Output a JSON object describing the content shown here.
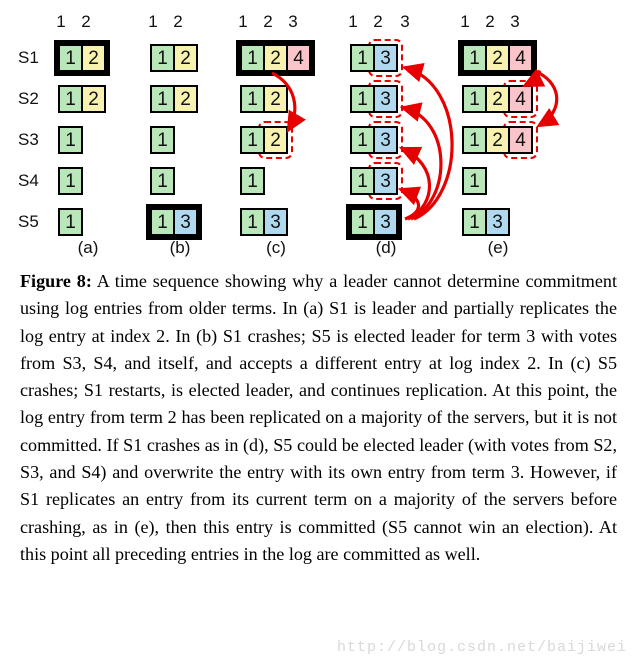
{
  "figure": {
    "row_labels": [
      "S1",
      "S2",
      "S3",
      "S4",
      "S5"
    ],
    "panels": [
      {
        "id": "a",
        "label": "(a)",
        "column_headers": [
          "1",
          "2"
        ],
        "rows": [
          {
            "server": "S1",
            "leader": true,
            "cells": [
              {
                "term": "1",
                "color": "green"
              },
              {
                "term": "2",
                "color": "yellow"
              }
            ]
          },
          {
            "server": "S2",
            "leader": false,
            "cells": [
              {
                "term": "1",
                "color": "green"
              },
              {
                "term": "2",
                "color": "yellow"
              }
            ]
          },
          {
            "server": "S3",
            "leader": false,
            "cells": [
              {
                "term": "1",
                "color": "green"
              }
            ]
          },
          {
            "server": "S4",
            "leader": false,
            "cells": [
              {
                "term": "1",
                "color": "green"
              }
            ]
          },
          {
            "server": "S5",
            "leader": false,
            "cells": [
              {
                "term": "1",
                "color": "green"
              }
            ]
          }
        ]
      },
      {
        "id": "b",
        "label": "(b)",
        "column_headers": [
          "1",
          "2"
        ],
        "rows": [
          {
            "server": "S1",
            "leader": false,
            "cells": [
              {
                "term": "1",
                "color": "green"
              },
              {
                "term": "2",
                "color": "yellow"
              }
            ]
          },
          {
            "server": "S2",
            "leader": false,
            "cells": [
              {
                "term": "1",
                "color": "green"
              },
              {
                "term": "2",
                "color": "yellow"
              }
            ]
          },
          {
            "server": "S3",
            "leader": false,
            "cells": [
              {
                "term": "1",
                "color": "green"
              }
            ]
          },
          {
            "server": "S4",
            "leader": false,
            "cells": [
              {
                "term": "1",
                "color": "green"
              }
            ]
          },
          {
            "server": "S5",
            "leader": true,
            "cells": [
              {
                "term": "1",
                "color": "green"
              },
              {
                "term": "3",
                "color": "blue"
              }
            ]
          }
        ]
      },
      {
        "id": "c",
        "label": "(c)",
        "column_headers": [
          "1",
          "2",
          "3"
        ],
        "rows": [
          {
            "server": "S1",
            "leader": true,
            "cells": [
              {
                "term": "1",
                "color": "green"
              },
              {
                "term": "2",
                "color": "yellow"
              },
              {
                "term": "4",
                "color": "pink"
              }
            ]
          },
          {
            "server": "S2",
            "leader": false,
            "cells": [
              {
                "term": "1",
                "color": "green"
              },
              {
                "term": "2",
                "color": "yellow"
              }
            ]
          },
          {
            "server": "S3",
            "leader": false,
            "cells": [
              {
                "term": "1",
                "color": "green"
              },
              {
                "term": "2",
                "color": "yellow",
                "highlight": true
              }
            ]
          },
          {
            "server": "S4",
            "leader": false,
            "cells": [
              {
                "term": "1",
                "color": "green"
              }
            ]
          },
          {
            "server": "S5",
            "leader": false,
            "cells": [
              {
                "term": "1",
                "color": "green"
              },
              {
                "term": "3",
                "color": "blue"
              }
            ]
          }
        ]
      },
      {
        "id": "d",
        "label": "(d)",
        "column_headers": [
          "1",
          "2",
          "3"
        ],
        "rows": [
          {
            "server": "S1",
            "leader": false,
            "cells": [
              {
                "term": "1",
                "color": "green"
              },
              {
                "term": "3",
                "color": "blue",
                "highlight": true
              }
            ]
          },
          {
            "server": "S2",
            "leader": false,
            "cells": [
              {
                "term": "1",
                "color": "green"
              },
              {
                "term": "3",
                "color": "blue",
                "highlight": true
              }
            ]
          },
          {
            "server": "S3",
            "leader": false,
            "cells": [
              {
                "term": "1",
                "color": "green"
              },
              {
                "term": "3",
                "color": "blue",
                "highlight": true
              }
            ]
          },
          {
            "server": "S4",
            "leader": false,
            "cells": [
              {
                "term": "1",
                "color": "green"
              },
              {
                "term": "3",
                "color": "blue",
                "highlight": true
              }
            ]
          },
          {
            "server": "S5",
            "leader": true,
            "cells": [
              {
                "term": "1",
                "color": "green"
              },
              {
                "term": "3",
                "color": "blue"
              }
            ]
          }
        ]
      },
      {
        "id": "e",
        "label": "(e)",
        "column_headers": [
          "1",
          "2",
          "3"
        ],
        "rows": [
          {
            "server": "S1",
            "leader": true,
            "cells": [
              {
                "term": "1",
                "color": "green"
              },
              {
                "term": "2",
                "color": "yellow"
              },
              {
                "term": "4",
                "color": "pink"
              }
            ]
          },
          {
            "server": "S2",
            "leader": false,
            "cells": [
              {
                "term": "1",
                "color": "green"
              },
              {
                "term": "2",
                "color": "yellow"
              },
              {
                "term": "4",
                "color": "pink",
                "highlight": true
              }
            ]
          },
          {
            "server": "S3",
            "leader": false,
            "cells": [
              {
                "term": "1",
                "color": "green"
              },
              {
                "term": "2",
                "color": "yellow"
              },
              {
                "term": "4",
                "color": "pink",
                "highlight": true
              }
            ]
          },
          {
            "server": "S4",
            "leader": false,
            "cells": [
              {
                "term": "1",
                "color": "green"
              }
            ]
          },
          {
            "server": "S5",
            "leader": false,
            "cells": [
              {
                "term": "1",
                "color": "green"
              },
              {
                "term": "3",
                "color": "blue"
              }
            ]
          }
        ]
      }
    ],
    "colors": {
      "term1_green": "#b9e7b9",
      "term2_yellow": "#f7f2b0",
      "term3_blue": "#b0d9ef",
      "term4_pink": "#f9c5ca",
      "arrow_red": "#e60000",
      "border_black": "#000000"
    }
  },
  "caption": {
    "figure_number": "Figure 8:",
    "text": " A time sequence showing why a leader cannot determine commitment using log entries from older terms. In (a) S1 is leader and partially replicates the log entry at index 2. In (b) S1 crashes; S5 is elected leader for term 3 with votes from S3, S4, and itself, and accepts a different entry at log index 2. In (c) S5 crashes; S1 restarts, is elected leader, and continues replication. At this point, the log entry from term 2 has been replicated on a majority of the servers, but it is not committed. If S1 crashes as in (d), S5 could be elected leader (with votes from S2, S3, and S4) and overwrite the entry with its own entry from term 3. However, if S1 replicates an entry from its current term on a majority of the servers before crashing, as in (e), then this entry is committed (S5 cannot win an election). At this point all preceding entries in the log are committed as well."
  },
  "watermark": {
    "url": "http://blog.csdn.net/baijiwei"
  }
}
